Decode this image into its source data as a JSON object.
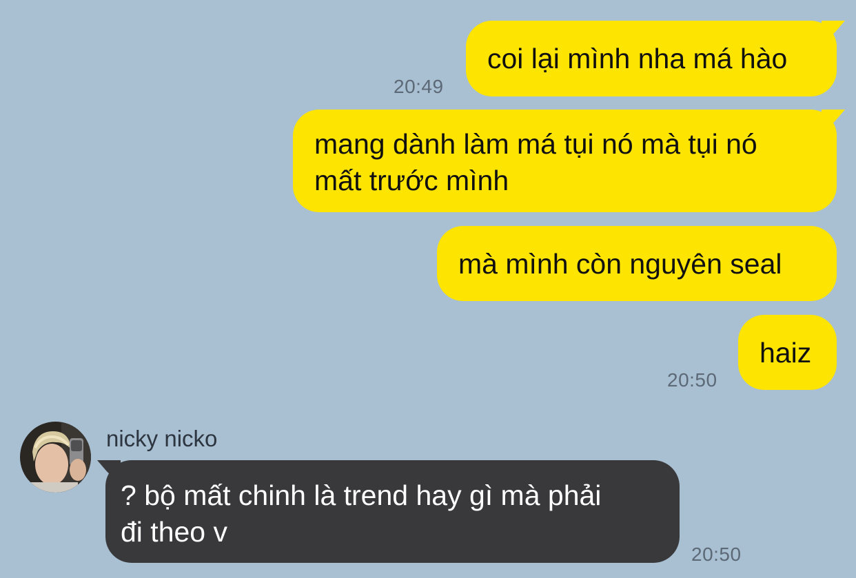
{
  "colors": {
    "background": "#a9bfd2",
    "outgoing_bubble": "#fde401",
    "incoming_bubble": "#39393b"
  },
  "messages": [
    {
      "direction": "outgoing",
      "text": "coi lại mình nha má hào",
      "time": "20:49"
    },
    {
      "direction": "outgoing",
      "text": "mang dành làm má tụi nó mà tụi nó\nmất trước mình"
    },
    {
      "direction": "outgoing",
      "text": "mà mình còn nguyên seal"
    },
    {
      "direction": "outgoing",
      "text": "haiz",
      "time": "20:50"
    },
    {
      "direction": "incoming",
      "sender": "nicky nicko",
      "text": "? bộ mất chinh là trend hay gì mà phải\nđi theo v",
      "time": "20:50"
    }
  ]
}
